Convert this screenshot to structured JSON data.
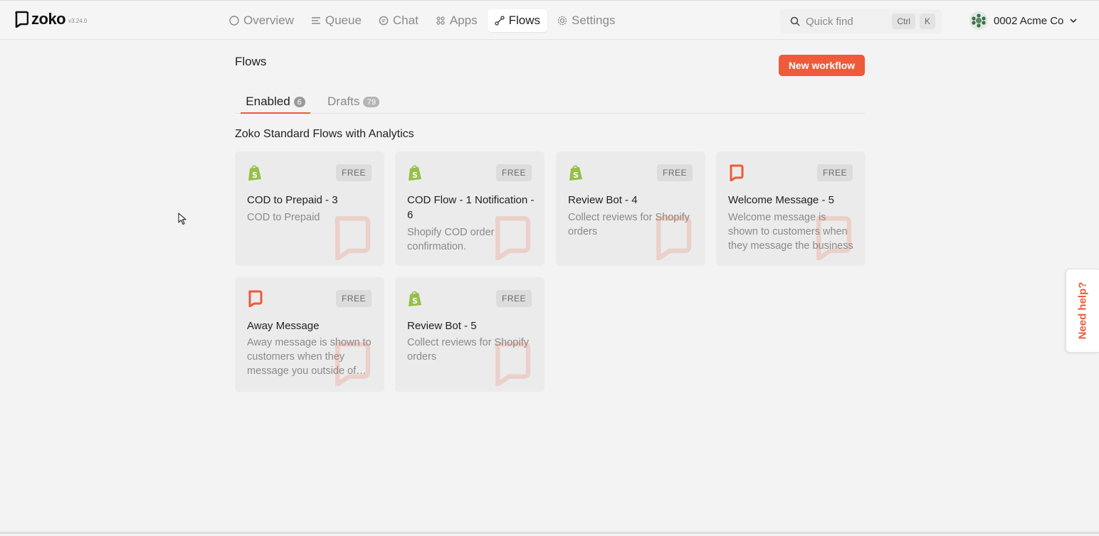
{
  "app": {
    "name": "zoko",
    "version": "v3.24.0"
  },
  "nav": {
    "items": [
      {
        "label": "Overview",
        "icon": "circle-icon",
        "active": false
      },
      {
        "label": "Queue",
        "icon": "list-icon",
        "active": false
      },
      {
        "label": "Chat",
        "icon": "chat-icon",
        "active": false
      },
      {
        "label": "Apps",
        "icon": "grid-icon",
        "active": false
      },
      {
        "label": "Flows",
        "icon": "flow-icon",
        "active": true
      },
      {
        "label": "Settings",
        "icon": "gear-icon",
        "active": false
      }
    ]
  },
  "search": {
    "placeholder": "Quick find",
    "shortcut": [
      "Ctrl",
      "K"
    ]
  },
  "account": {
    "name": "0002 Acme Co"
  },
  "page": {
    "title": "Flows",
    "new_button": "New workflow"
  },
  "tabs": [
    {
      "label": "Enabled",
      "count": "6",
      "active": true
    },
    {
      "label": "Drafts",
      "count": "79",
      "active": false
    }
  ],
  "section": {
    "title": "Zoko Standard Flows with Analytics"
  },
  "cards": [
    {
      "title": "COD to Prepaid - 3",
      "description": "COD to Prepaid",
      "badge": "FREE",
      "icon": "shopify-icon"
    },
    {
      "title": "COD Flow - 1 Notification - 6",
      "description": "Shopify COD order confirmation.",
      "badge": "FREE",
      "icon": "shopify-icon"
    },
    {
      "title": "Review Bot - 4",
      "description": "Collect reviews for Shopify orders",
      "badge": "FREE",
      "icon": "shopify-icon"
    },
    {
      "title": "Welcome Message - 5",
      "description": "Welcome message is shown to customers when they message the business",
      "badge": "FREE",
      "icon": "zoko-icon"
    },
    {
      "title": "Away Message",
      "description": "Away message is shown to customers when they message you outside of business hours",
      "badge": "FREE",
      "icon": "zoko-icon"
    },
    {
      "title": "Review Bot - 5",
      "description": "Collect reviews for Shopify orders",
      "badge": "FREE",
      "icon": "shopify-icon"
    }
  ],
  "help": {
    "label": "Need help?"
  },
  "colors": {
    "accent": "#ef5a3a",
    "shopify": "#95bf47",
    "background": "#f3f3f3"
  }
}
